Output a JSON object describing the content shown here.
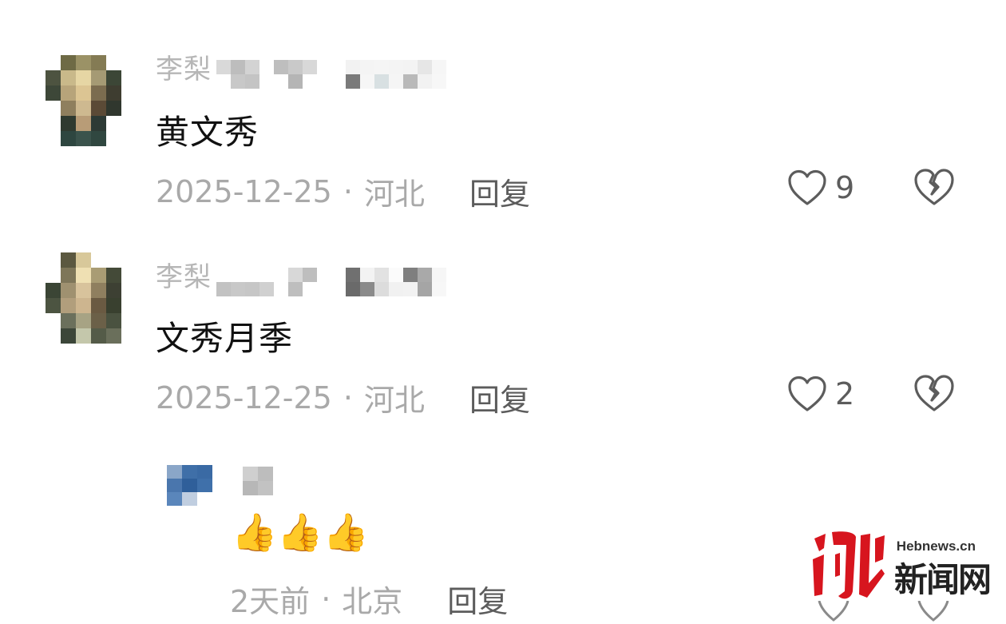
{
  "comments": [
    {
      "username": "李梨",
      "content": "黄文秀",
      "date": "2025-12-25",
      "separator": "·",
      "location": "河北",
      "reply_label": "回复",
      "like_count": "9"
    },
    {
      "username": "李梨",
      "content": "文秀月季",
      "date": "2025-12-25",
      "separator": "·",
      "location": "河北",
      "reply_label": "回复",
      "like_count": "2"
    }
  ],
  "sub_comment": {
    "content": "👍👍👍",
    "date": "2天前",
    "separator": "·",
    "location": "北京",
    "reply_label": "回复"
  },
  "watermark": {
    "site": "Hebnews.cn",
    "brand": "新闻网"
  },
  "icons": {
    "like": "heart-outline-icon",
    "dislike": "broken-heart-icon",
    "thumbs_up": "thumbs-up-emoji"
  },
  "colors": {
    "username": "#b6b6b6",
    "content": "#111111",
    "meta": "#a9a9a9",
    "action": "#5c5c5c",
    "brand_red": "#d7151e"
  }
}
